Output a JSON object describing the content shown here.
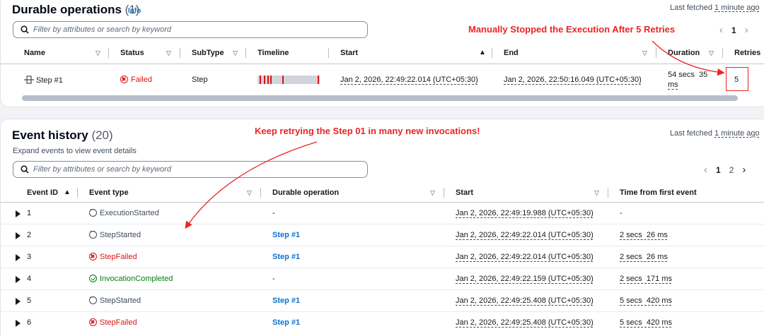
{
  "durable": {
    "title": "Durable operations",
    "count": "(1)",
    "info": "Info",
    "last_fetched_label": "Last fetched",
    "last_fetched_value": "1 minute ago",
    "search_placeholder": "Filter by attributes or search by keyword",
    "pager": {
      "page": "1"
    },
    "columns": [
      "Name",
      "Status",
      "SubType",
      "Timeline",
      "Start",
      "End",
      "Duration",
      "Retries"
    ],
    "row": {
      "name": "Step #1",
      "status": "Failed",
      "subtype": "Step",
      "start": "Jan 2, 2026, 22:49:22.014 (UTC+05:30)",
      "end": "Jan 2, 2026, 22:50:16.049 (UTC+05:30)",
      "duration_line1": "54 secs  35",
      "duration_line2": "ms",
      "retries": "5"
    }
  },
  "history": {
    "title": "Event history",
    "count": "(20)",
    "subtitle": "Expand events to view event details",
    "last_fetched_label": "Last fetched",
    "last_fetched_value": "1 minute ago",
    "search_placeholder": "Filter by attributes or search by keyword",
    "pager": {
      "page1": "1",
      "page2": "2"
    },
    "columns": [
      "Event ID",
      "Event type",
      "Durable operation",
      "Start",
      "Time from first event"
    ],
    "rows": [
      {
        "id": "1",
        "type": "ExecutionStarted",
        "operation": "-",
        "start": "Jan 2, 2026, 22:49:19.988 (UTC+05:30)",
        "elapsed": "-"
      },
      {
        "id": "2",
        "type": "StepStarted",
        "operation": "Step #1",
        "start": "Jan 2, 2026, 22:49:22.014 (UTC+05:30)",
        "elapsed": "2 secs  26 ms"
      },
      {
        "id": "3",
        "type": "StepFailed",
        "operation": "Step #1",
        "start": "Jan 2, 2026, 22:49:22.014 (UTC+05:30)",
        "elapsed": "2 secs  26 ms"
      },
      {
        "id": "4",
        "type": "InvocationCompleted",
        "operation": "-",
        "start": "Jan 2, 2026, 22:49:22.159 (UTC+05:30)",
        "elapsed": "2 secs  171 ms"
      },
      {
        "id": "5",
        "type": "StepStarted",
        "operation": "Step #1",
        "start": "Jan 2, 2026, 22:49:25.408 (UTC+05:30)",
        "elapsed": "5 secs  420 ms"
      },
      {
        "id": "6",
        "type": "StepFailed",
        "operation": "Step #1",
        "start": "Jan 2, 2026, 22:49:25.408 (UTC+05:30)",
        "elapsed": "5 secs  420 ms"
      }
    ]
  },
  "annotations": {
    "top": "Manually Stopped the Execution After 5 Retries",
    "middle": "Keep retrying the Step 01 in many new invocations!",
    "color": "#ec2424"
  },
  "colors": {
    "failed": "#d91515",
    "success": "#037f0c",
    "link": "#0972d3"
  }
}
